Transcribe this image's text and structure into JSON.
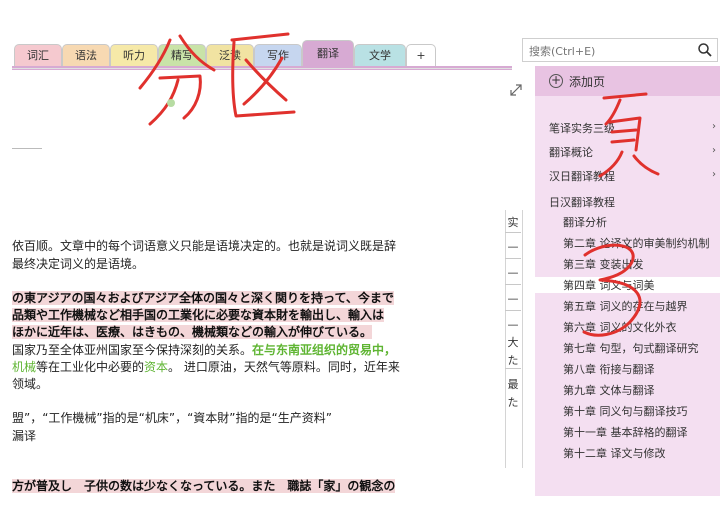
{
  "tabs": [
    {
      "label": "词汇",
      "color": "#f5c9cf"
    },
    {
      "label": "语法",
      "color": "#f7d9b2"
    },
    {
      "label": "听力",
      "color": "#f6e9a8"
    },
    {
      "label": "精写",
      "color": "#c9e3a8"
    },
    {
      "label": "泛读",
      "color": "#f1e3a2"
    },
    {
      "label": "写作",
      "color": "#c6d6ef"
    },
    {
      "label": "翻译",
      "color": "#d7aad3"
    },
    {
      "label": "文学",
      "color": "#b9e1e4"
    },
    {
      "label": "+",
      "color": "#ffffff"
    }
  ],
  "search": {
    "placeholder": "搜索(Ctrl+E)"
  },
  "panel": {
    "add_page": "添加页",
    "pages": [
      {
        "label": "笔译实务三级",
        "indent": 0
      },
      {
        "label": "翻译概论",
        "indent": 0
      },
      {
        "label": "汉日翻译教程",
        "indent": 0
      },
      {
        "label": "日汉翻译教程",
        "indent": 0
      },
      {
        "label": "翻译分析",
        "indent": 1
      },
      {
        "label": "第二章 论译文的审美制约机制",
        "indent": 1
      },
      {
        "label": "第三章 变装出发",
        "indent": 1
      },
      {
        "label": "第四章 词义与词美",
        "indent": 1,
        "selected": true
      },
      {
        "label": "第五章 词义的存在与越界",
        "indent": 1
      },
      {
        "label": "第六章 词义的文化外衣",
        "indent": 1
      },
      {
        "label": "第七章 句型，句式翻译研究",
        "indent": 1
      },
      {
        "label": "第八章 衔接与翻译",
        "indent": 1
      },
      {
        "label": "第九章 文体与翻译",
        "indent": 1
      },
      {
        "label": "第十章 同义句与翻译技巧",
        "indent": 1
      },
      {
        "label": "第十一章 基本辞格的翻译",
        "indent": 1
      },
      {
        "label": "第十二章 译文与修改",
        "indent": 1
      }
    ]
  },
  "content": {
    "p1_l1": "依百顺。文章中的每个词语意义只能是语境决定的。也就是说词义既是辞",
    "p1_l2": "最终决定词义的是语境。",
    "jp_l1": "の東アジアの国々およびアジア全体の国々と深く関りを持って、今まで",
    "jp_l2": "品類や工作機械など相手国の工業化に必要な資本財を輸出し、輸入は",
    "jp_l3": "ほかに近年は、医療、はきもの、機械類などの輸入が伸びている。",
    "cn_l1a": "国家乃至全体亚州国家至今保持深刻的关系。",
    "cn_l1b": "在与东南亚组织的贸易中，",
    "cn_l2a": "机械",
    "cn_l2b": "等在工业化中必要的",
    "cn_l2c": "资本",
    "cn_l2d": "。 进口原油，天然气等原料。同时，近年来",
    "cn_l3": "领域。",
    "note_l1": "盟”，“工作機械”指的是“机床”，“資本財”指的是“生产资料”",
    "note_l2": "漏译",
    "bottom_l1": "方が普及し　子供の数は少なくなっている。また　職誌「家」の観念の"
  },
  "narrow_col": [
    "实",
    "—",
    "—",
    "—",
    "—",
    "大",
    "た",
    "最",
    "た"
  ],
  "handwriting": {
    "left": "分区",
    "right_top": "页",
    "right_mid": "3"
  },
  "colors": {
    "accent": "#d7aad3",
    "ink": "#e0312d",
    "panel": "#f4dff1"
  }
}
